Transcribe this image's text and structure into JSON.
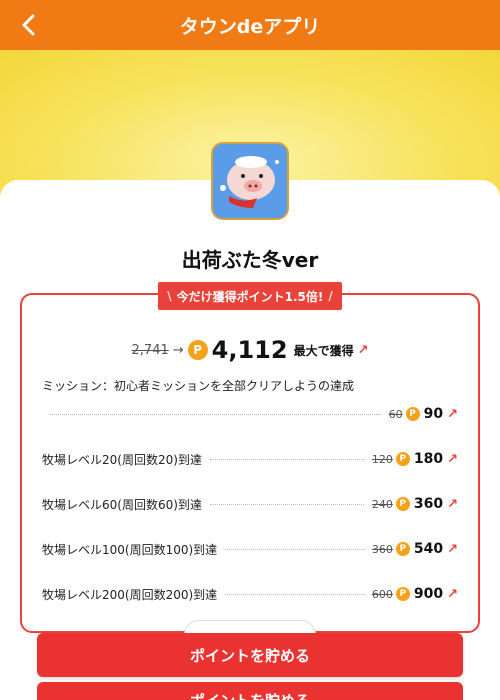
{
  "header": {
    "title": "タウンdeアプリ"
  },
  "app": {
    "name": "出荷ぶた冬ver"
  },
  "promo": {
    "ribbon": "今だけ獲得ポイント1.5倍!"
  },
  "total": {
    "old": "2,741",
    "arrow": "→",
    "points": "4,112",
    "suffix": "最大で獲得"
  },
  "mission": "ミッション：初心者ミッションを全部クリアしようの達成",
  "coin_letter": "P",
  "ext_icon": "↗",
  "rows": [
    {
      "label": "",
      "old": "60",
      "new": "90"
    },
    {
      "label": "牧場レベル20(周回数20)到達",
      "old": "120",
      "new": "180"
    },
    {
      "label": "牧場レベル60(周回数60)到達",
      "old": "240",
      "new": "360"
    },
    {
      "label": "牧場レベル100(周回数100)到達",
      "old": "360",
      "new": "540"
    },
    {
      "label": "牧場レベル200(周回数200)到達",
      "old": "600",
      "new": "900"
    }
  ],
  "cta": {
    "primary": "ポイントを貯める",
    "secondary": "ポイントを貯める"
  },
  "colors": {
    "header": "#f07a14",
    "accent": "#e8423a",
    "coin": "#f5a21a",
    "hero": "#f7e35c"
  }
}
